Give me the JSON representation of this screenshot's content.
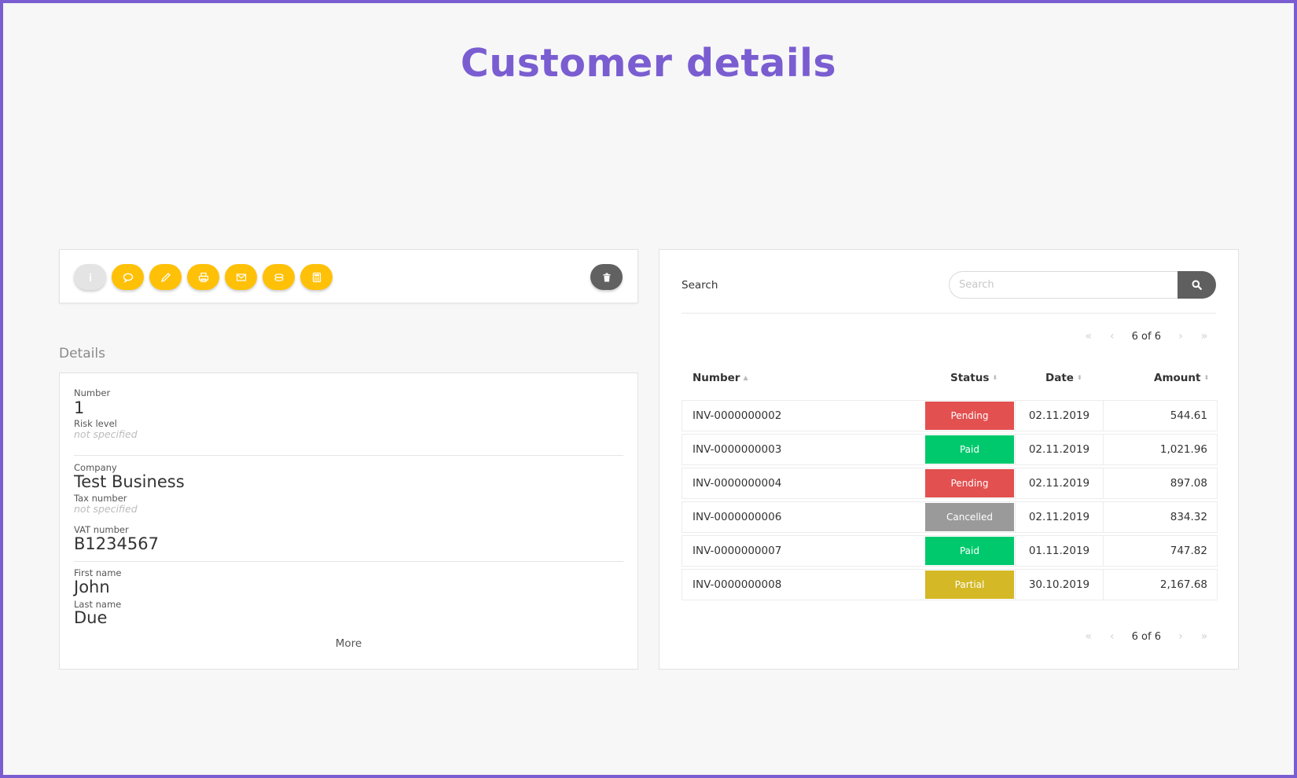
{
  "page": {
    "title": "Customer details"
  },
  "toolbar": {
    "buttons": [
      {
        "icon": "info-icon",
        "color": "#e4e4e4"
      },
      {
        "icon": "comment-icon",
        "color": "#ffc107"
      },
      {
        "icon": "pencil-icon",
        "color": "#ffc107"
      },
      {
        "icon": "print-icon",
        "color": "#ffc107"
      },
      {
        "icon": "envelope-icon",
        "color": "#ffc107"
      },
      {
        "icon": "money-icon",
        "color": "#ffc107"
      },
      {
        "icon": "calculator-icon",
        "color": "#ffc107"
      }
    ],
    "delete_icon": "trash-icon",
    "accent": "#ffc107"
  },
  "details": {
    "heading": "Details",
    "number_label": "Number",
    "number_value": "1",
    "risk_label": "Risk level",
    "risk_value": "not specified",
    "company_label": "Company",
    "company_value": "Test Business",
    "tax_label": "Tax number",
    "tax_value": "not specified",
    "vat_label": "VAT number",
    "vat_value": "B1234567",
    "first_label": "First name",
    "first_value": "John",
    "last_label": "Last name",
    "last_value": "Due",
    "more": "More"
  },
  "invoices": {
    "search_label": "Search",
    "search_placeholder": "Search",
    "pager_text": "6 of 6",
    "columns": {
      "number": "Number",
      "status": "Status",
      "date": "Date",
      "amount": "Amount"
    },
    "rows": [
      {
        "number": "INV-0000000002",
        "status": "Pending",
        "date": "02.11.2019",
        "amount": "544.61"
      },
      {
        "number": "INV-0000000003",
        "status": "Paid",
        "date": "02.11.2019",
        "amount": "1,021.96"
      },
      {
        "number": "INV-0000000004",
        "status": "Pending",
        "date": "02.11.2019",
        "amount": "897.08"
      },
      {
        "number": "INV-0000000006",
        "status": "Cancelled",
        "date": "02.11.2019",
        "amount": "834.32"
      },
      {
        "number": "INV-0000000007",
        "status": "Paid",
        "date": "01.11.2019",
        "amount": "747.82"
      },
      {
        "number": "INV-0000000008",
        "status": "Partial",
        "date": "30.10.2019",
        "amount": "2,167.68"
      }
    ],
    "status_colors": {
      "Pending": "#e35050",
      "Paid": "#00c96d",
      "Cancelled": "#9a9a9a",
      "Partial": "#d4b825"
    }
  },
  "colors": {
    "brand": "#7a5dd1"
  }
}
